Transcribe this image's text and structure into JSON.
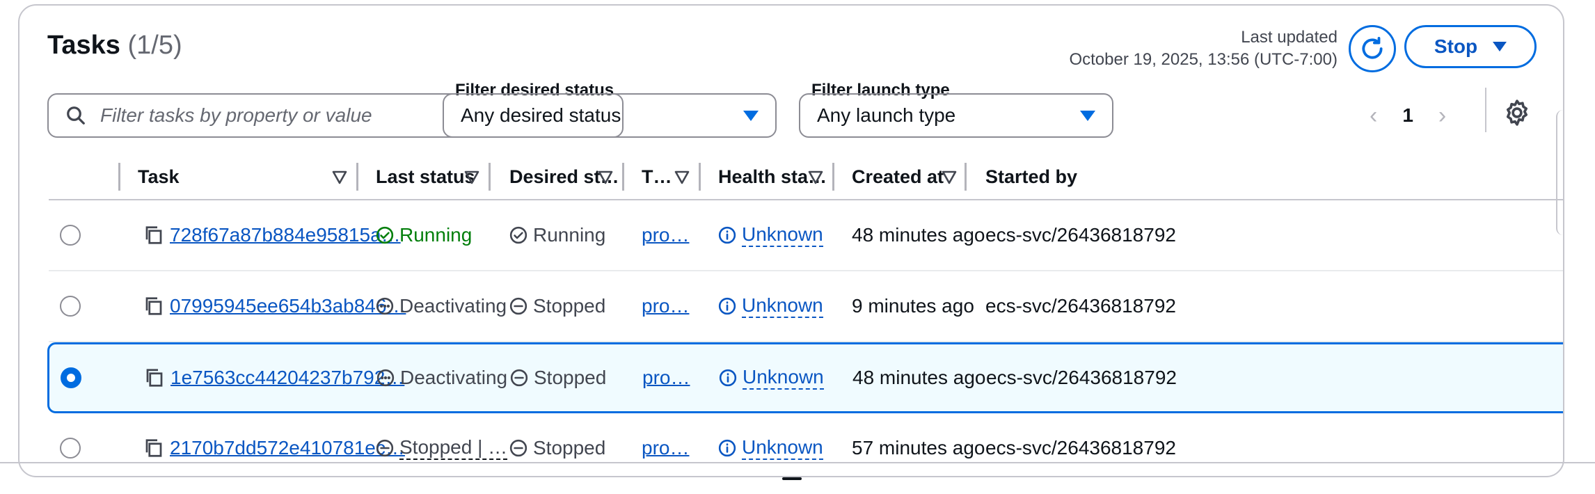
{
  "header": {
    "title": "Tasks",
    "count": "(1/5)",
    "last_updated_label": "Last updated",
    "last_updated_value": "October 19, 2025, 13:56 (UTC-7:00)",
    "stop_label": "Stop"
  },
  "filters": {
    "search_placeholder": "Filter tasks by property or value",
    "desired_status_label": "Filter desired status",
    "desired_status_value": "Any desired status",
    "launch_type_label": "Filter launch type",
    "launch_type_value": "Any launch type"
  },
  "pagination": {
    "prev": "‹",
    "page": "1",
    "next": "›"
  },
  "columns": {
    "task": "Task",
    "last_status": "Last status",
    "desired_status": "Desired st…",
    "task_def": "T…",
    "health": "Health sta…",
    "created": "Created at",
    "started_by": "Started by"
  },
  "rows": [
    {
      "task": "728f67a87b884e95815a…",
      "last_status": "Running",
      "desired_status": "Running",
      "task_def": "pro…",
      "health": "Unknown",
      "created": "48 minutes ago",
      "started_by": "ecs-svc/26436818792"
    },
    {
      "task": "07995945ee654b3ab846…",
      "last_status": "Deactivating",
      "desired_status": "Stopped",
      "task_def": "pro…",
      "health": "Unknown",
      "created": "9 minutes ago",
      "started_by": "ecs-svc/26436818792"
    },
    {
      "task": "1e7563cc44204237b792…",
      "last_status": "Deactivating",
      "desired_status": "Stopped",
      "task_def": "pro…",
      "health": "Unknown",
      "created": "48 minutes ago",
      "started_by": "ecs-svc/26436818792"
    },
    {
      "task": "2170b7dd572e410781ec…",
      "last_status": "Stopped | …",
      "desired_status": "Stopped",
      "task_def": "pro…",
      "health": "Unknown",
      "created": "57 minutes ago",
      "started_by": "ecs-svc/26436818792"
    }
  ],
  "colors": {
    "accent": "#006ce0",
    "link": "#0a56c2",
    "success": "#037f0c",
    "selected_bg": "#f0fbff"
  }
}
